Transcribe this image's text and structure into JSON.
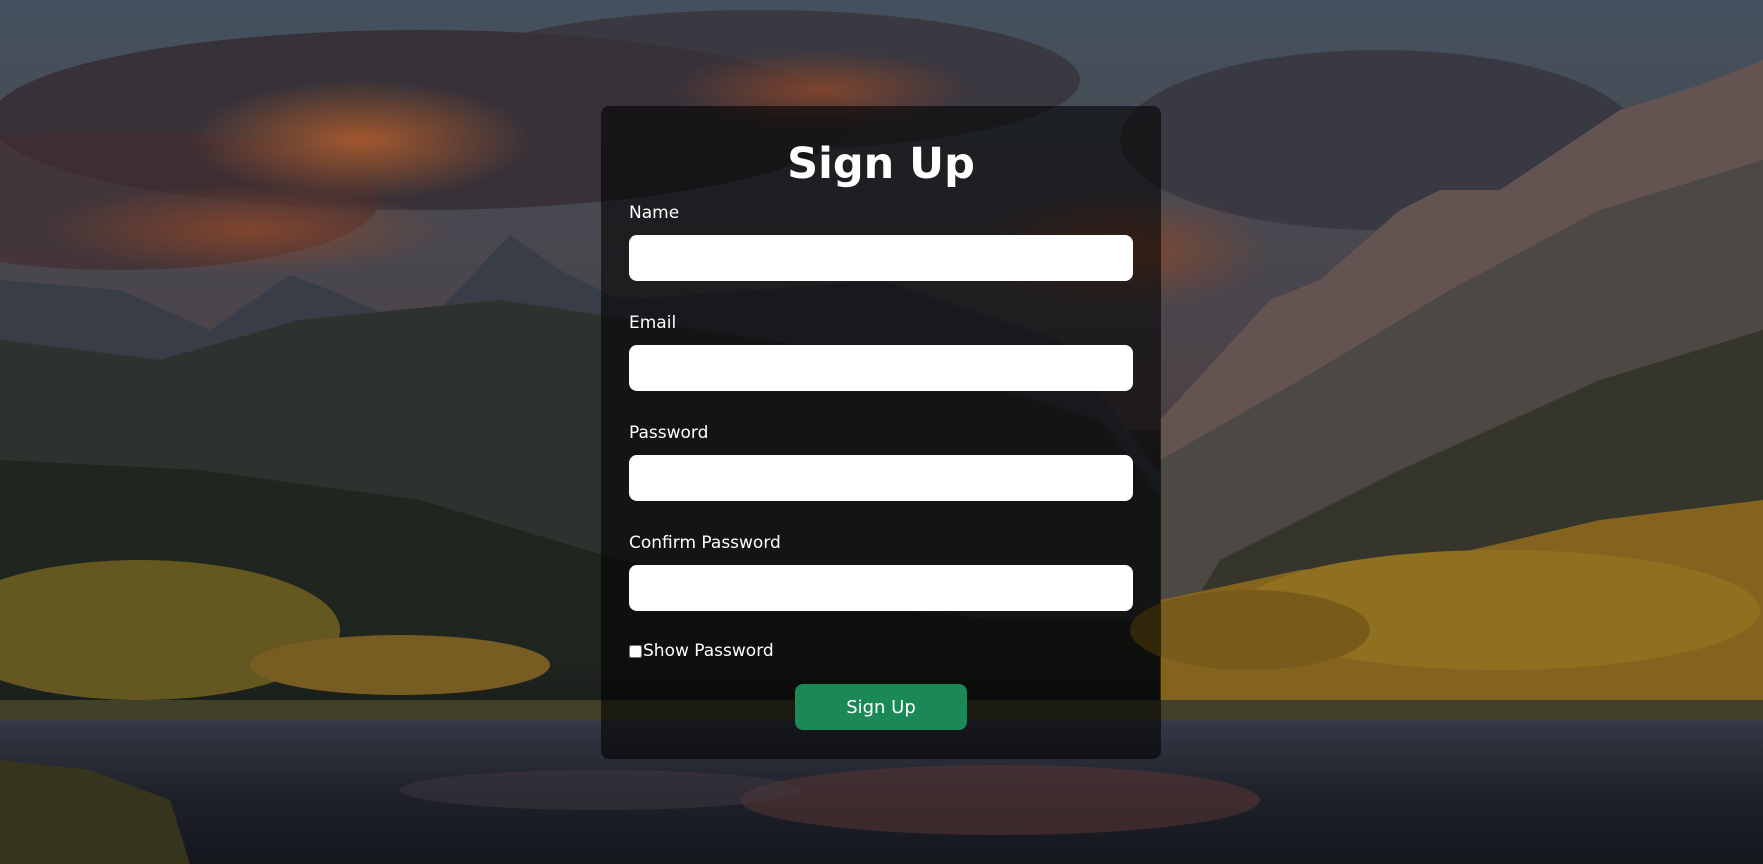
{
  "form": {
    "title": "Sign Up",
    "fields": [
      {
        "label": "Name",
        "value": "",
        "placeholder": ""
      },
      {
        "label": "Email",
        "value": "",
        "placeholder": ""
      },
      {
        "label": "Password",
        "value": "",
        "placeholder": ""
      },
      {
        "label": "Confirm Password",
        "value": "",
        "placeholder": ""
      }
    ],
    "show_password_label": "Show Password",
    "show_password_checked": false,
    "submit_label": "Sign Up",
    "submit_color": "#1a8955"
  },
  "background": {
    "description_icon": "mountain-lake-sunset-image"
  }
}
